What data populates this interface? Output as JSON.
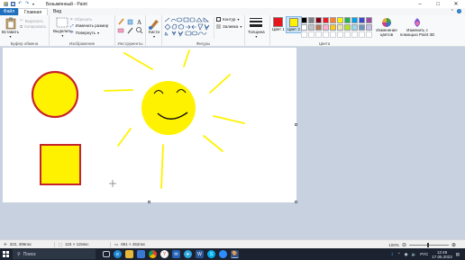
{
  "window": {
    "title": "Безымянный - Paint",
    "minimize": "–",
    "maximize": "□",
    "close": "✕"
  },
  "tabs": {
    "file": "Файл",
    "home": "Главная",
    "view": "Вид"
  },
  "ribbon": {
    "clipboard": {
      "paste": "Вставить",
      "cut": "Вырезать",
      "copy": "Копировать",
      "label": "Буфер обмена"
    },
    "image": {
      "select": "Выделить",
      "crop": "Обрезать",
      "resize": "Изменить размер",
      "rotate": "Повернуть",
      "label": "Изображение"
    },
    "tools": {
      "label": "Инструменты"
    },
    "brushes": {
      "label": "Кисти"
    },
    "shapes": {
      "outline": "Контур",
      "fill": "Заливка",
      "label": "Фигуры"
    },
    "size": {
      "label": "Толщина"
    },
    "colors": {
      "color1": "Цвет 1",
      "color2": "Цвет 2",
      "edit": "Изменение цветов",
      "paint3d": "Изменить с помощью Paint 3D",
      "label": "Цвета",
      "color1_value": "#e8151c",
      "color2_value": "#fff200",
      "palette": [
        "#000000",
        "#7f7f7f",
        "#880015",
        "#ed1c24",
        "#ff7f27",
        "#fff200",
        "#22b14c",
        "#00a2e8",
        "#3f48cc",
        "#a349a4",
        "#ffffff",
        "#c3c3c3",
        "#b97a57",
        "#ffaec9",
        "#ffc90e",
        "#efe4b0",
        "#b5e61d",
        "#99d9ea",
        "#7092be",
        "#c8bfe7"
      ]
    }
  },
  "status": {
    "cursor": "322, 396пкс",
    "selection": "115 × 115пкс",
    "canvas_size": "861 × 452пкс",
    "zoom": "100%"
  },
  "taskbar": {
    "search_placeholder": "Поиск",
    "lang": "РУС",
    "time": "12:49",
    "date": "17.05.2023"
  }
}
